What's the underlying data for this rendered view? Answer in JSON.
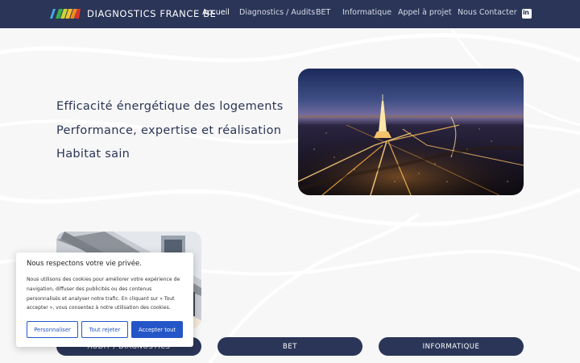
{
  "header": {
    "logo_text": "DIAGNOSTICS FRANCE BE",
    "nav": [
      {
        "label": "Accueil",
        "active": true
      },
      {
        "label": "Diagnostics / Audits",
        "active": false
      },
      {
        "label": "BET",
        "active": false
      },
      {
        "label": "Informatique",
        "active": false
      },
      {
        "label": "Appel à projet",
        "active": false
      },
      {
        "label": "Nous Contacter",
        "active": false
      }
    ],
    "social_icon": "linkedin-icon",
    "social_glyph": "in"
  },
  "hero": {
    "lines": [
      "Efficacité énergétique des logements",
      "Performance, expertise et réalisation",
      "Habitat sain"
    ]
  },
  "services": {
    "buttons": [
      "AUDIT / DIAGNOSTICS",
      "BET",
      "INFORMATIQUE"
    ]
  },
  "cookie_banner": {
    "title": "Nous respectons votre vie privée.",
    "body_lines": [
      "Nous utilisons des cookies pour améliorer votre expérience de",
      "navigation, diffuser des publicités ou des contenus",
      "personnalisés et analyser notre trafic. En cliquant sur « Tout",
      "accepter », vous consentez à notre utilisation des cookies."
    ],
    "customize_label": "Personnaliser",
    "reject_label": "Tout rejeter",
    "accept_label": "Accepter tout"
  },
  "colors": {
    "navy": "#2a3558",
    "cookie_blue": "#2456c7",
    "background": "#f7f7f8"
  }
}
